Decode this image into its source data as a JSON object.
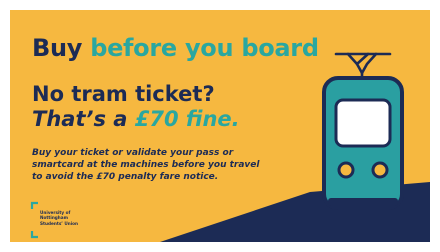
{
  "colors": {
    "background": "#f6b840",
    "navy": "#1c2b55",
    "teal": "#2aa7a0",
    "tram_body": "#2a9fa1",
    "window": "#ffffff",
    "headlight": "#f6b840"
  },
  "headline": {
    "part1": "Buy ",
    "part2": "before you board"
  },
  "subheadline": {
    "line1": "No tram ticket?",
    "line2_prefix": "That’s a ",
    "line2_amount": "£70 fine."
  },
  "body_text": "Buy your ticket or validate your pass or smartcard at the machines before you travel to avoid the £70 penalty fare notice.",
  "logo": {
    "line1": "University of",
    "line2": "Nottingham",
    "line3": "Students’ Union"
  },
  "icons": {
    "tram": "tram-icon",
    "logo_mark": "su-bracket-logo"
  }
}
